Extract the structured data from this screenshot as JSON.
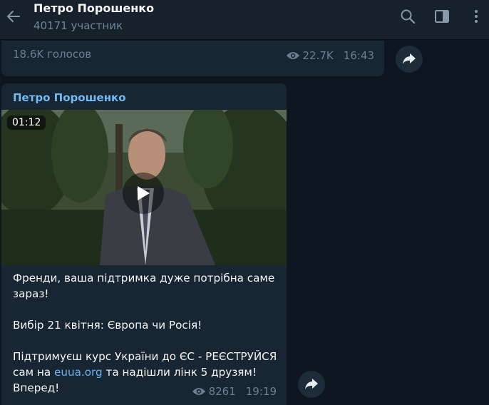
{
  "header": {
    "title": "Петро Порошенко",
    "subtitle": "40171 участник",
    "icons": [
      "back-arrow-icon",
      "search-icon",
      "sidebar-toggle-icon",
      "more-vertical-icon"
    ]
  },
  "prev_message": {
    "votes": "18.6K голосов",
    "views": "22.7K",
    "time": "16:43"
  },
  "message": {
    "author": "Петро Порошенко",
    "video_duration": "01:12",
    "text": {
      "line1": "Френди, ваша підтримка дуже потрібна саме зараз!",
      "line2": "Вибір 21 квітня: Європа чи Росія!",
      "line3_a": "Підтримуєш курс України до ЄС - РЕЄСТРУЙСЯ сам на ",
      "link": "euua.org",
      "line3_b": " та надішли лінк 5 друзям! Вперед!"
    },
    "views": "8261",
    "time": "19:19"
  },
  "colors": {
    "background": "#0e1621",
    "header": "#17212b",
    "bubble": "#182533",
    "author": "#71baf2",
    "link": "#6ab3f3",
    "meta": "#6d7f8f"
  }
}
